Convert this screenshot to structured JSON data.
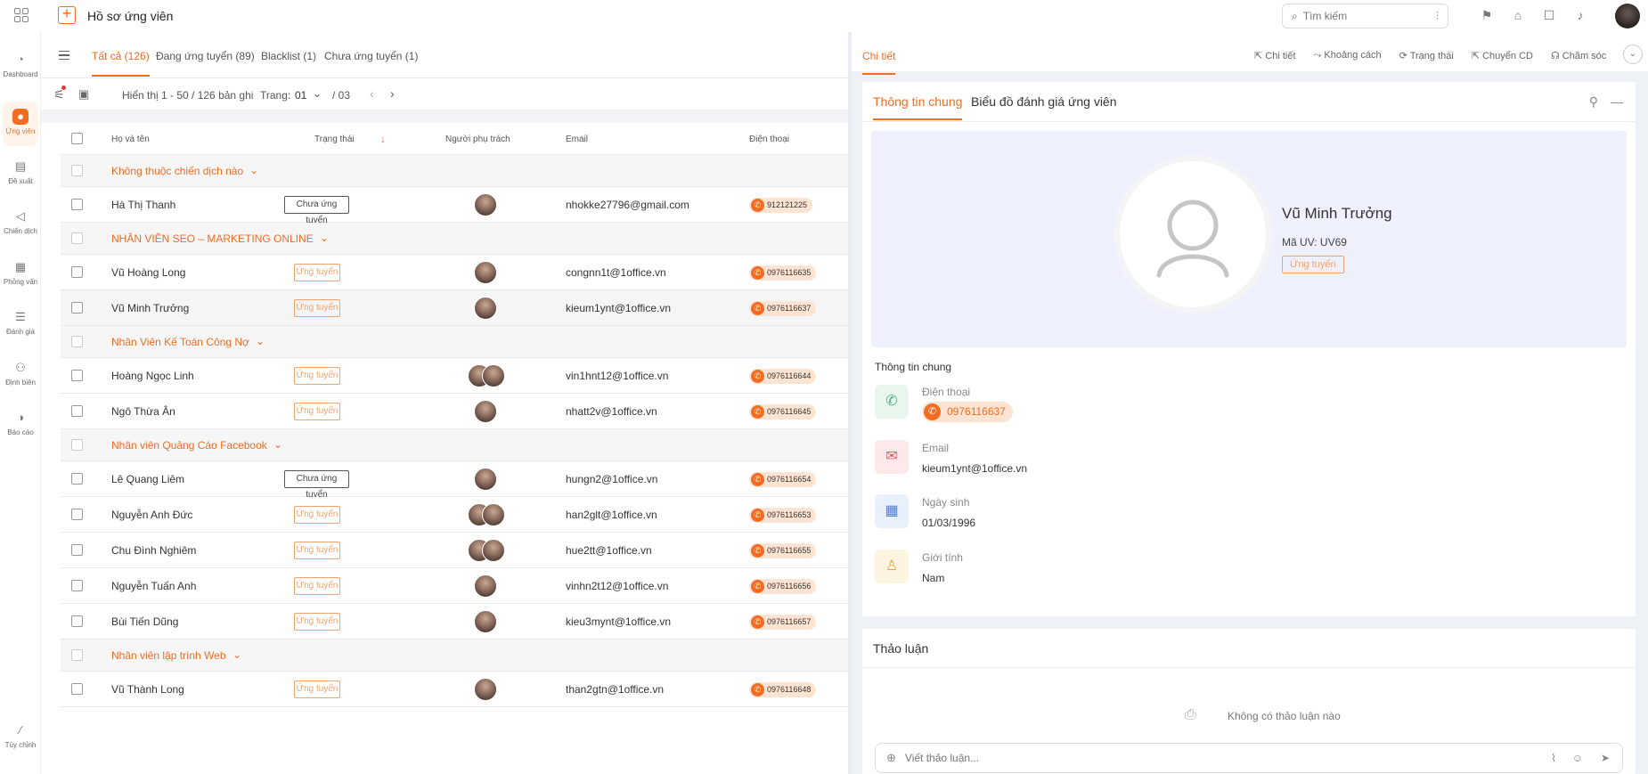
{
  "header": {
    "title": "Hồ sơ ứng viên",
    "search_placeholder": "Tìm kiếm"
  },
  "nav": [
    {
      "label": "Dashboard",
      "icon": "chart-icon"
    },
    {
      "label": "Ứng viên",
      "icon": "user-icon",
      "active": true
    },
    {
      "label": "Đề xuất",
      "icon": "clipboard-icon"
    },
    {
      "label": "Chiến dịch",
      "icon": "megaphone-icon"
    },
    {
      "label": "Phỏng vấn",
      "icon": "calendar-icon"
    },
    {
      "label": "Đánh giá",
      "icon": "checklist-icon"
    },
    {
      "label": "Định biên",
      "icon": "team-icon"
    },
    {
      "label": "Báo cáo",
      "icon": "pie-icon"
    },
    {
      "label": "Tùy chỉnh",
      "icon": "wand-icon"
    }
  ],
  "list": {
    "tabs": [
      "Tất cả (126)",
      "Đang ứng tuyển (89)",
      "Blacklist (1)",
      "Chưa ứng tuyển (1)"
    ],
    "showing": "Hiển thị 1 - 50 / 126 bản ghi",
    "page_label": "Trang:",
    "page_current": "01",
    "page_total": "/ 03",
    "columns": {
      "name": "Họ và tên",
      "status": "Trạng thái",
      "owner": "Người phụ trách",
      "email": "Email",
      "phone": "Điện thoại"
    },
    "rows": [
      {
        "type": "group",
        "label": "Không thuộc chiến dịch nào"
      },
      {
        "type": "item",
        "name": "Hà Thị Thanh",
        "status": "Chưa ứng tuyển",
        "dark": true,
        "avatars": 1,
        "email": "nhokke27796@gmail.com",
        "phone": "912121225"
      },
      {
        "type": "group",
        "label": "NHÂN VIÊN SEO – MARKETING ONLINE"
      },
      {
        "type": "item",
        "name": "Vũ Hoàng Long",
        "status": "Ứng tuyển",
        "avatars": 1,
        "email": "congnn1t@1office.vn",
        "phone": "0976116635"
      },
      {
        "type": "item",
        "name": "Vũ Minh Trưởng",
        "status": "Ứng tuyển",
        "avatars": 1,
        "email": "kieum1ynt@1office.vn",
        "phone": "0976116637",
        "highlight": true
      },
      {
        "type": "group",
        "label": "Nhân Viên Kế Toán Công Nợ"
      },
      {
        "type": "item",
        "name": "Hoàng Ngọc Linh",
        "status": "Ứng tuyển",
        "avatars": 2,
        "email": "vin1hnt12@1office.vn",
        "phone": "0976116644"
      },
      {
        "type": "item",
        "name": "Ngô Thừa Ân",
        "status": "Ứng tuyển",
        "avatars": 1,
        "email": "nhatt2v@1office.vn",
        "phone": "0976116645"
      },
      {
        "type": "group",
        "label": "Nhân viên Quảng Cáo Facebook"
      },
      {
        "type": "item",
        "name": "Lê Quang Liêm",
        "status": "Chưa ứng tuyển",
        "dark": true,
        "avatars": 1,
        "email": "hungn2@1office.vn",
        "phone": "0976116654"
      },
      {
        "type": "item",
        "name": "Nguyễn Anh Đức",
        "status": "Ứng tuyển",
        "avatars": 2,
        "email": "han2glt@1office.vn",
        "phone": "0976116653"
      },
      {
        "type": "item",
        "name": "Chu Đình Nghiêm",
        "status": "Ứng tuyển",
        "avatars": 2,
        "email": "hue2tt@1office.vn",
        "phone": "0976116655"
      },
      {
        "type": "item",
        "name": "Nguyễn Tuấn Anh",
        "status": "Ứng tuyển",
        "avatars": 1,
        "email": "vinhn2t12@1office.vn",
        "phone": "0976116656"
      },
      {
        "type": "item",
        "name": "Bùi Tiến Dũng",
        "status": "Ứng tuyển",
        "avatars": 1,
        "email": "kieu3mynt@1office.vn",
        "phone": "0976116657"
      },
      {
        "type": "group",
        "label": "Nhân viên lập trình Web"
      },
      {
        "type": "item",
        "name": "Vũ Thành Long",
        "status": "Ứng tuyển",
        "avatars": 1,
        "email": "than2gtn@1office.vn",
        "phone": "0976116648"
      }
    ]
  },
  "detail": {
    "tab": "Chi tiết",
    "actions": [
      "Chi tiết",
      "Khoảng cách",
      "Trạng thái",
      "Chuyển CD",
      "Chăm sóc"
    ],
    "card_tabs": [
      "Thông tin chung",
      "Biểu đồ đánh giá ứng viên"
    ],
    "name": "Vũ Minh Trưởng",
    "code": "Mã UV: UV69",
    "status": "Ứng tuyển",
    "section_title": "Thông tin chung",
    "phone_label": "Điện thoại",
    "phone": "0976116637",
    "email_label": "Email",
    "email": "kieum1ynt@1office.vn",
    "dob_label": "Ngày sinh",
    "dob": "01/03/1996",
    "gender_label": "Giới tính",
    "gender": "Nam",
    "discussion_title": "Thảo luận",
    "no_discussion": "Không có thảo luận nào",
    "comment_placeholder": "Viết thảo luận..."
  },
  "colors": {
    "accent": "#f26c21",
    "status_border": "#f5a36b",
    "phone_bg": "#fde4d2",
    "profile_bg": "#eff0fe"
  }
}
